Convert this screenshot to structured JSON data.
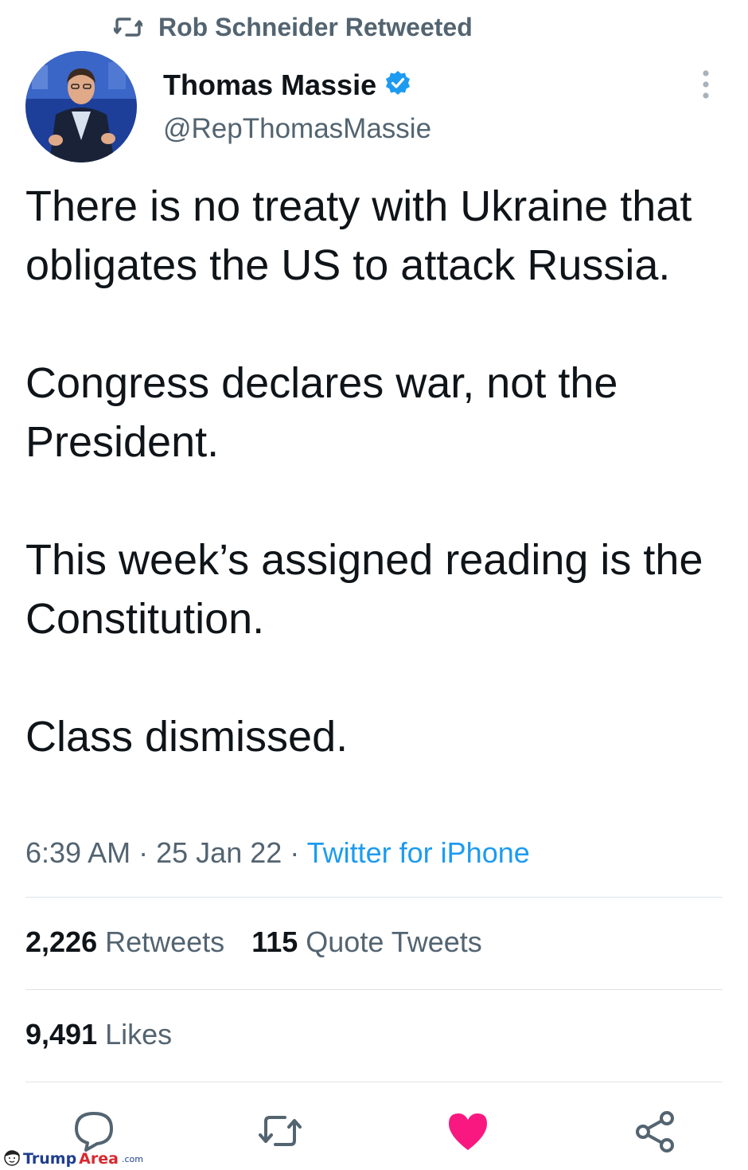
{
  "retweet_banner": {
    "icon": "retweet-icon",
    "label": "Rob Schneider Retweeted"
  },
  "author": {
    "avatar": "avatar-photo",
    "name": "Thomas Massie",
    "verified_icon": "verified-badge-icon",
    "handle": "@RepThomasMassie"
  },
  "more_icon": "more-vertical-icon",
  "tweet": {
    "paragraphs": [
      "There is no treaty with Ukraine that obligates the US to attack Russia.",
      "Congress declares war, not the President.",
      "This week’s assigned reading is the Constitution.",
      "Class dismissed."
    ]
  },
  "meta": {
    "time": "6:39 AM",
    "separator": "·",
    "date": "25 Jan 22",
    "source": "Twitter for iPhone"
  },
  "stats": {
    "retweets_count": "2,226",
    "retweets_label": "Retweets",
    "quotes_count": "115",
    "quotes_label": "Quote Tweets",
    "likes_count": "9,491",
    "likes_label": "Likes"
  },
  "actions": [
    {
      "icon": "reply-icon"
    },
    {
      "icon": "retweet-icon"
    },
    {
      "icon": "heart-icon",
      "liked": true
    },
    {
      "icon": "share-icon"
    }
  ],
  "watermark": {
    "part1": "Trump",
    "part2": "Area",
    "part3": ".com"
  },
  "colors": {
    "accent": "#1d9bf0",
    "like": "#f91880",
    "secondary_text": "#536471",
    "primary_text": "#0f1419"
  }
}
